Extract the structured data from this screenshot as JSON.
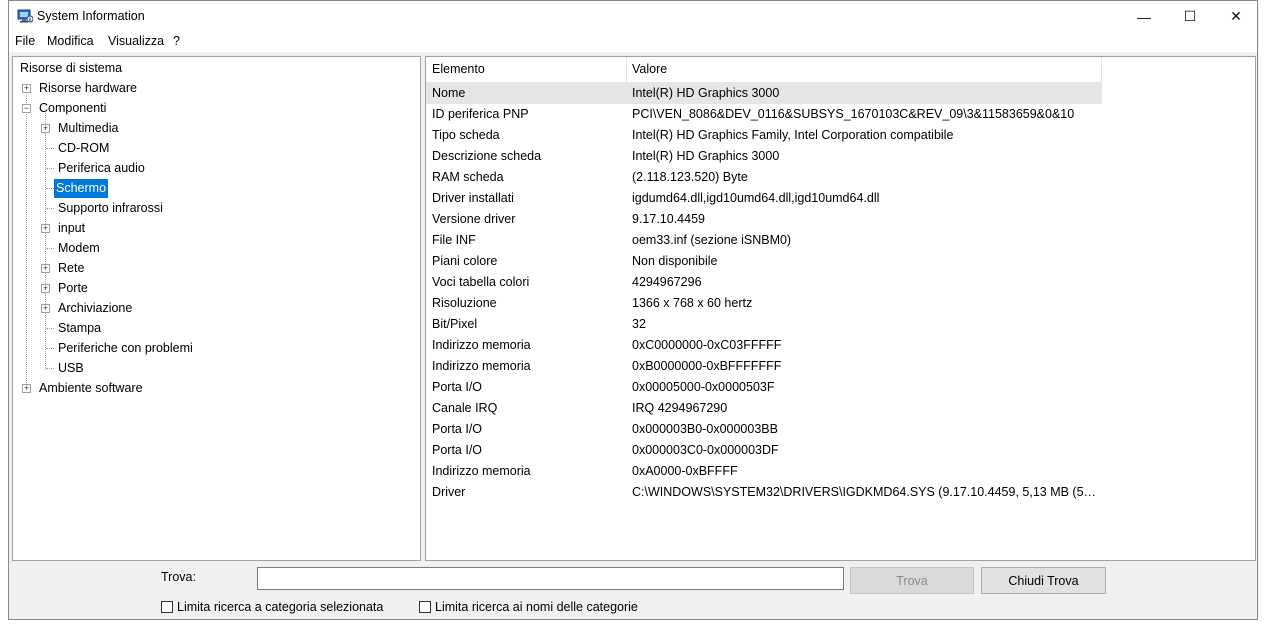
{
  "window": {
    "title": "System Information",
    "controls": {
      "minimize": "—",
      "maximize": "☐",
      "close": "✕"
    }
  },
  "menu": [
    "File",
    "Modifica",
    "Visualizza",
    "?"
  ],
  "tree": [
    {
      "label": "Risorse di sistema",
      "level": 0,
      "expander": ""
    },
    {
      "label": "Risorse hardware",
      "level": 1,
      "expander": "+"
    },
    {
      "label": "Componenti",
      "level": 1,
      "expander": "−"
    },
    {
      "label": "Multimedia",
      "level": 2,
      "expander": "+"
    },
    {
      "label": "CD-ROM",
      "level": 2,
      "expander": ""
    },
    {
      "label": "Periferica audio",
      "level": 2,
      "expander": ""
    },
    {
      "label": "Schermo",
      "level": 2,
      "expander": "",
      "selected": true
    },
    {
      "label": "Supporto infrarossi",
      "level": 2,
      "expander": ""
    },
    {
      "label": "input",
      "level": 2,
      "expander": "+"
    },
    {
      "label": "Modem",
      "level": 2,
      "expander": ""
    },
    {
      "label": "Rete",
      "level": 2,
      "expander": "+"
    },
    {
      "label": "Porte",
      "level": 2,
      "expander": "+"
    },
    {
      "label": "Archiviazione",
      "level": 2,
      "expander": "+"
    },
    {
      "label": "Stampa",
      "level": 2,
      "expander": ""
    },
    {
      "label": "Periferiche con problemi",
      "level": 2,
      "expander": ""
    },
    {
      "label": "USB",
      "level": 2,
      "expander": ""
    },
    {
      "label": "Ambiente software",
      "level": 1,
      "expander": "+"
    }
  ],
  "list": {
    "columns": [
      "Elemento",
      "Valore"
    ],
    "rows": [
      [
        "Nome",
        "Intel(R) HD Graphics 3000"
      ],
      [
        "ID periferica PNP",
        "PCI\\VEN_8086&DEV_0116&SUBSYS_1670103C&REV_09\\3&11583659&0&10"
      ],
      [
        "Tipo scheda",
        "Intel(R) HD Graphics Family, Intel Corporation compatibile"
      ],
      [
        "Descrizione scheda",
        "Intel(R) HD Graphics 3000"
      ],
      [
        "RAM scheda",
        "(2.118.123.520) Byte"
      ],
      [
        "Driver installati",
        "igdumd64.dll,igd10umd64.dll,igd10umd64.dll"
      ],
      [
        "Versione driver",
        "9.17.10.4459"
      ],
      [
        "File INF",
        "oem33.inf (sezione iSNBM0)"
      ],
      [
        "Piani colore",
        "Non disponibile"
      ],
      [
        "Voci tabella colori",
        "4294967296"
      ],
      [
        "Risoluzione",
        "1366 x 768 x 60 hertz"
      ],
      [
        "Bit/Pixel",
        "32"
      ],
      [
        "Indirizzo memoria",
        "0xC0000000-0xC03FFFFF"
      ],
      [
        "Indirizzo memoria",
        "0xB0000000-0xBFFFFFFF"
      ],
      [
        "Porta I/O",
        "0x00005000-0x0000503F"
      ],
      [
        "Canale IRQ",
        "IRQ 4294967290"
      ],
      [
        "Porta I/O",
        "0x000003B0-0x000003BB"
      ],
      [
        "Porta I/O",
        "0x000003C0-0x000003DF"
      ],
      [
        "Indirizzo memoria",
        "0xA0000-0xBFFFF"
      ],
      [
        "Driver",
        "C:\\WINDOWS\\SYSTEM32\\DRIVERS\\IGDKMD64.SYS (9.17.10.4459, 5,13 MB (5.3..."
      ]
    ]
  },
  "find": {
    "label": "Trova:",
    "value": "",
    "find_button": "Trova",
    "close_button": "Chiudi Trova",
    "checkbox_category": "Limita ricerca a categoria selezionata",
    "checkbox_names": "Limita ricerca ai nomi delle categorie"
  }
}
